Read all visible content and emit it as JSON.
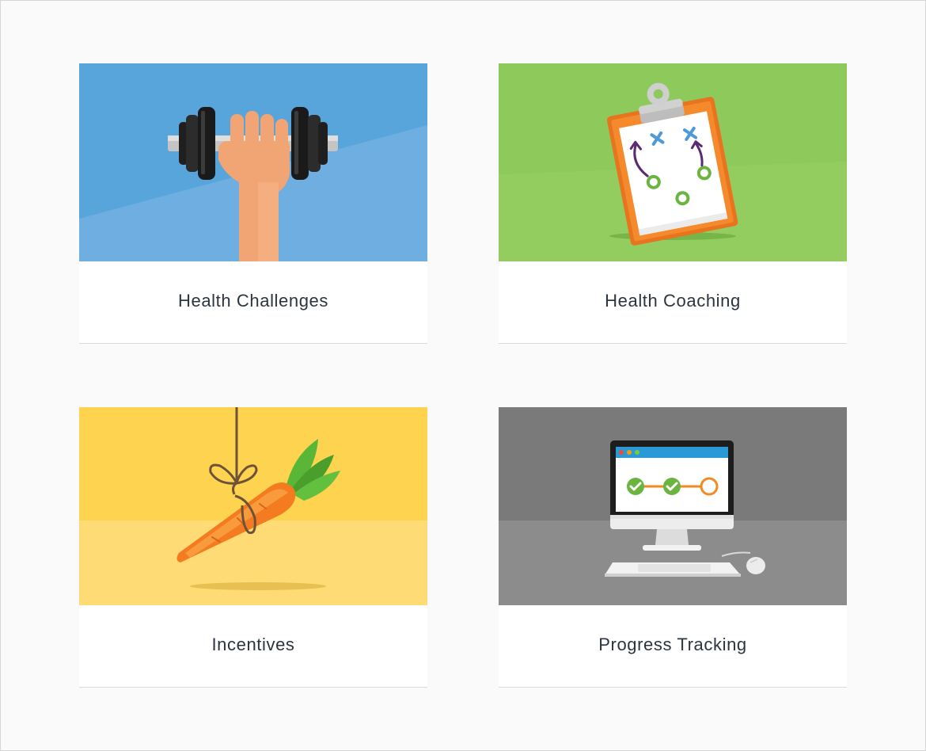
{
  "cards": [
    {
      "title": "Health Challenges",
      "illustration": "dumbbell-in-hand",
      "background_color": "#58a5dc"
    },
    {
      "title": "Health Coaching",
      "illustration": "clipboard-playbook",
      "background_color": "#8ec95b"
    },
    {
      "title": "Incentives",
      "illustration": "carrot-on-string",
      "background_color": "#fdd34f"
    },
    {
      "title": "Progress Tracking",
      "illustration": "desktop-computer-progress",
      "background_color": "#7a7a7a"
    }
  ]
}
